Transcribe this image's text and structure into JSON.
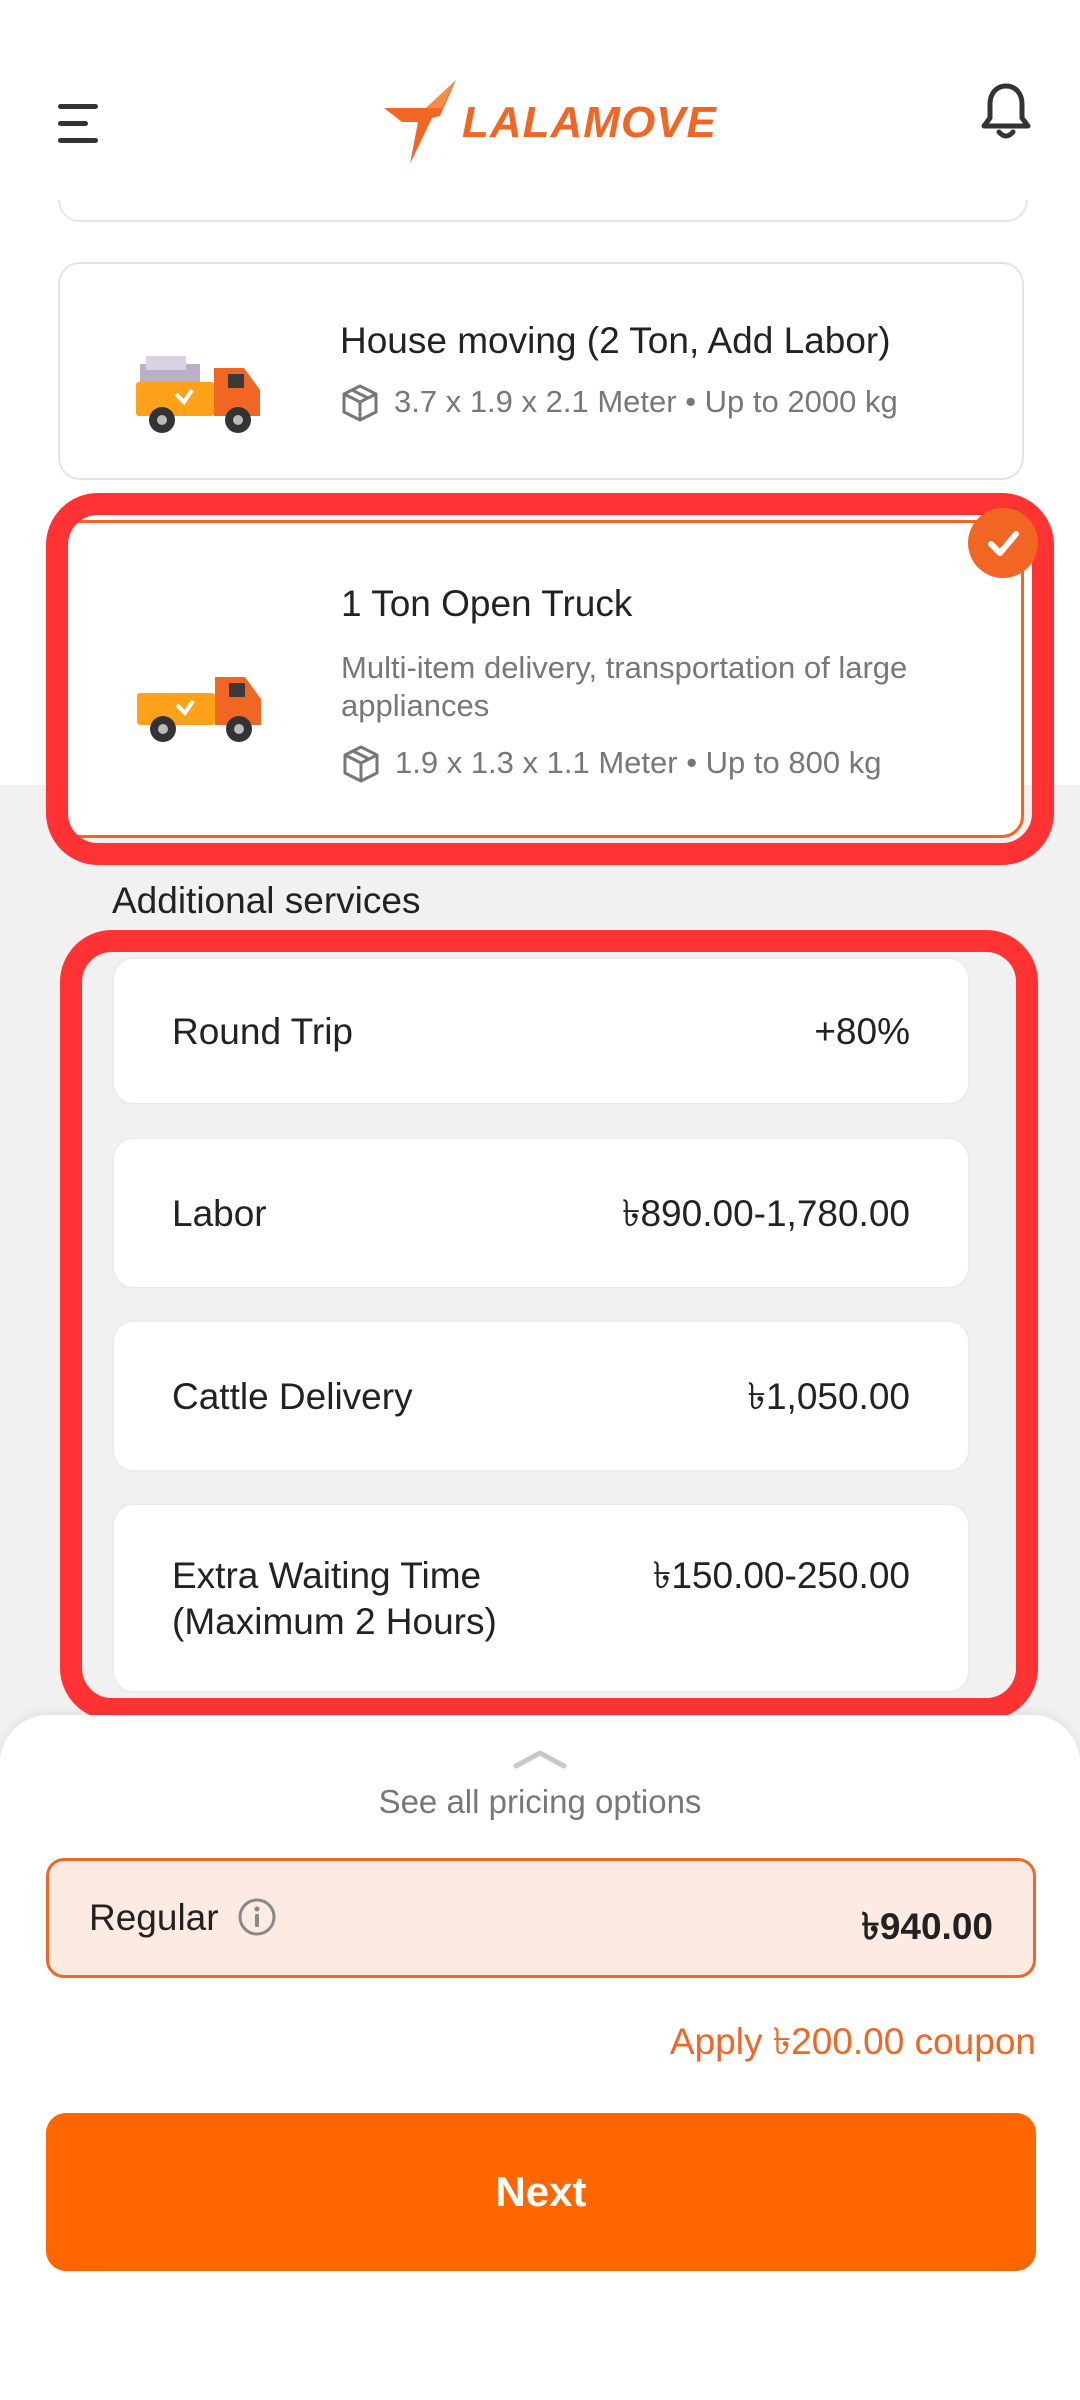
{
  "header": {
    "logo_text": "LALAMOVE",
    "brand_color": "#f16622",
    "icons": [
      "menu-icon",
      "bell-icon"
    ]
  },
  "vehicles": [
    {
      "title": "House moving (2 Ton, Add Labor)",
      "spec": "3.7 x 1.9 x 2.1 Meter • Up to 2000 kg",
      "selected": false
    },
    {
      "title": "1 Ton Open Truck",
      "description": "Multi-item delivery, transportation of large appliances",
      "spec": "1.9 x 1.3 x 1.1 Meter • Up to 800 kg",
      "selected": true
    }
  ],
  "additional_services": {
    "title": "Additional services",
    "items": [
      {
        "name": "Round Trip",
        "price": "+80%"
      },
      {
        "name": "Labor",
        "price": "৳890.00-1,780.00"
      },
      {
        "name": "Cattle Delivery",
        "price": "৳1,050.00"
      },
      {
        "name": "Extra Waiting Time\n(Maximum 2 Hours)",
        "price": "৳150.00-250.00"
      }
    ]
  },
  "pricing": {
    "see_all": "See all pricing options",
    "option_label": "Regular",
    "option_price": "৳940.00",
    "coupon": "Apply ৳200.00 coupon",
    "next_label": "Next"
  },
  "colors": {
    "accent": "#ff6600",
    "highlight": "#ff3333",
    "selected_bg": "#fdebe3"
  }
}
